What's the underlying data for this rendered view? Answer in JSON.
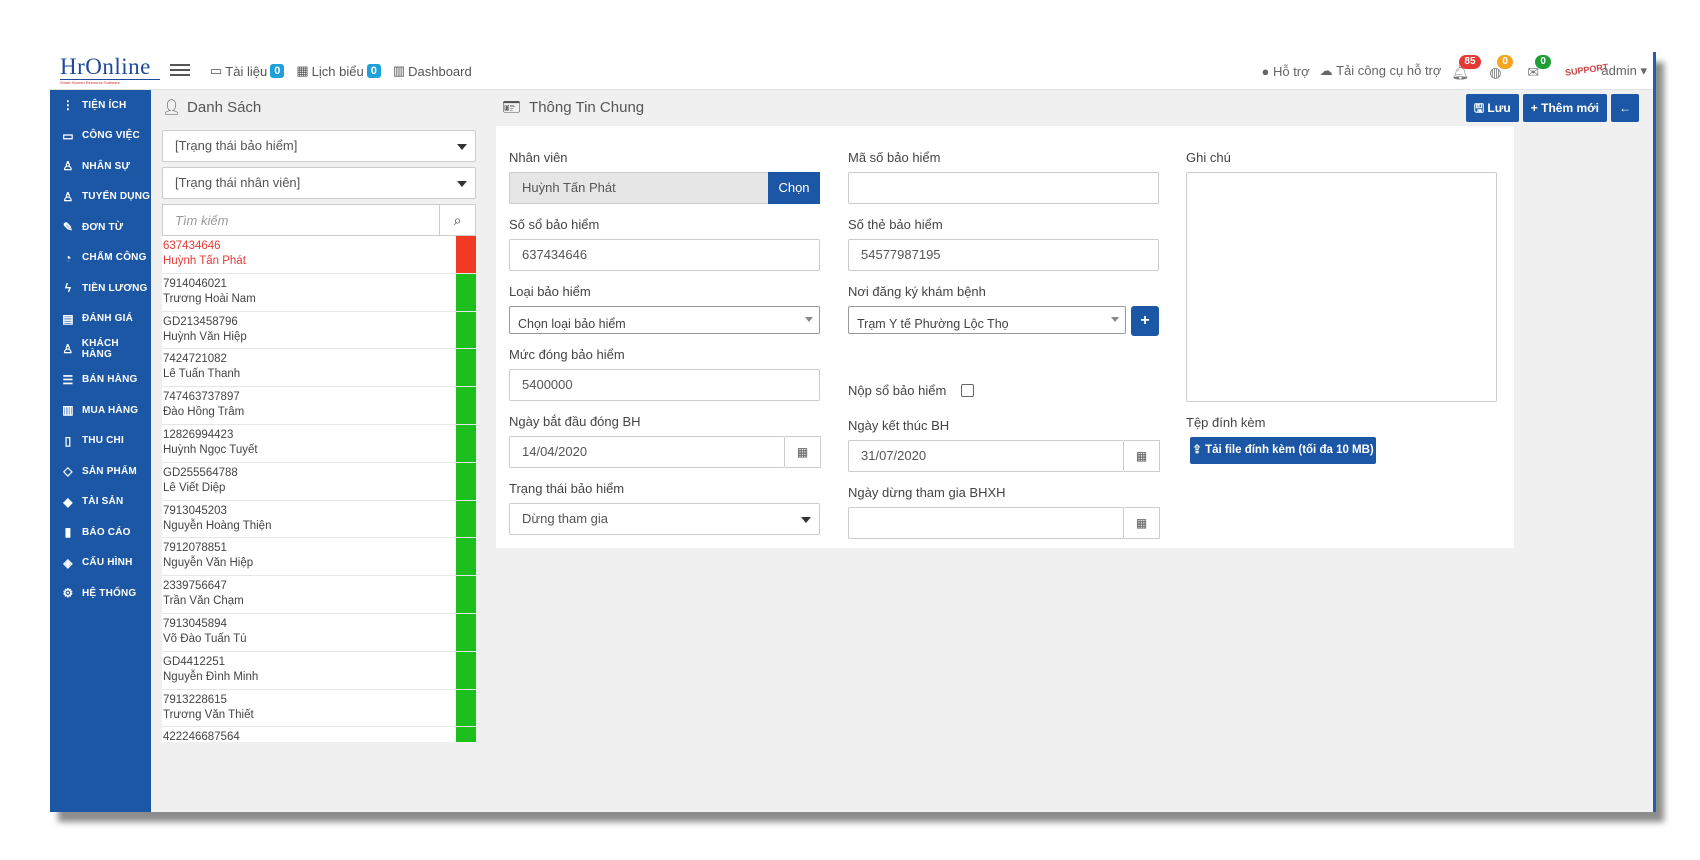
{
  "app": {
    "logo": "HrOnline",
    "logo_tagline": "Smart Human Resource Software"
  },
  "topnav": [
    {
      "label": "Tài liệu",
      "badge": "0",
      "icon": "folder-icon"
    },
    {
      "label": "Lịch biểu",
      "badge": "0",
      "icon": "calendar-icon"
    },
    {
      "label": "Dashboard",
      "icon": "bar-chart-icon"
    }
  ],
  "topright": {
    "support": "Hỗ trợ",
    "download_tool": "Tải công cụ hỗ trợ",
    "notifications": {
      "count": "85",
      "color": "#e53935"
    },
    "globe": {
      "count": "0",
      "color": "#f5a623"
    },
    "messages": {
      "count": "0",
      "color": "#1e9e34"
    },
    "avatar_text": "SUPPORT",
    "user": "admin"
  },
  "sidebar": [
    {
      "label": "TIỆN ÍCH",
      "icon": "more-vertical-icon"
    },
    {
      "label": "CÔNG VIỆC",
      "icon": "inbox-icon"
    },
    {
      "label": "NHÂN SỰ",
      "icon": "user-icon"
    },
    {
      "label": "TUYỂN DỤNG",
      "icon": "user-search-icon"
    },
    {
      "label": "ĐƠN TỪ",
      "icon": "edit-icon"
    },
    {
      "label": "CHẤM CÔNG",
      "icon": "clock-icon"
    },
    {
      "label": "TIỀN LƯƠNG",
      "icon": "bolt-icon"
    },
    {
      "label": "ĐÁNH GIÁ",
      "icon": "book-icon"
    },
    {
      "label": "KHÁCH HÀNG",
      "icon": "customer-icon"
    },
    {
      "label": "BÁN HÀNG",
      "icon": "list-icon"
    },
    {
      "label": "MUA HÀNG",
      "icon": "columns-icon"
    },
    {
      "label": "THU CHI",
      "icon": "file-icon"
    },
    {
      "label": "SẢN PHẨM",
      "icon": "tag-icon"
    },
    {
      "label": "TÀI SẢN",
      "icon": "diamond-icon"
    },
    {
      "label": "BÁO CÁO",
      "icon": "report-icon"
    },
    {
      "label": "CẤU HÌNH",
      "icon": "layers-icon"
    },
    {
      "label": "HỆ THỐNG",
      "icon": "settings-icon"
    }
  ],
  "list": {
    "title": "Danh Sách",
    "filter_insurance": "[Trạng thái bảo hiểm]",
    "filter_employee": "[Trạng thái nhân viên]",
    "search_placeholder": "Tìm kiếm",
    "items": [
      {
        "code": "637434646",
        "name": "Huỳnh Tấn Phát",
        "status_color": "#f03a24",
        "active": true
      },
      {
        "code": "7914046021",
        "name": "Trương Hoài Nam",
        "status_color": "#1cbf1c"
      },
      {
        "code": "GD213458796",
        "name": "Huỳnh Văn Hiệp",
        "status_color": "#1cbf1c"
      },
      {
        "code": "7424721082",
        "name": "Lê Tuấn Thanh",
        "status_color": "#1cbf1c"
      },
      {
        "code": "747463737897",
        "name": "Đào Hồng Trâm",
        "status_color": "#1cbf1c"
      },
      {
        "code": "12826994423",
        "name": "Huỳnh Ngọc Tuyết",
        "status_color": "#1cbf1c"
      },
      {
        "code": "GD255564788",
        "name": "Lê Viết Diệp",
        "status_color": "#1cbf1c"
      },
      {
        "code": "7913045203",
        "name": "Nguyễn Hoàng Thiện",
        "status_color": "#1cbf1c"
      },
      {
        "code": "7912078851",
        "name": "Nguyễn Văn Hiệp",
        "status_color": "#1cbf1c"
      },
      {
        "code": "2339756647",
        "name": "Trần Văn Chạm",
        "status_color": "#1cbf1c"
      },
      {
        "code": "7913045894",
        "name": "Võ Đào Tuấn Tú",
        "status_color": "#1cbf1c"
      },
      {
        "code": "GD4412251",
        "name": "Nguyễn Đình Minh",
        "status_color": "#1cbf1c"
      },
      {
        "code": "7913228615",
        "name": "Trương Văn Thiết",
        "status_color": "#1cbf1c"
      },
      {
        "code": "422246687564",
        "name": "",
        "status_color": "#1cbf1c"
      }
    ]
  },
  "detail": {
    "title": "Thông Tin Chung",
    "actions": {
      "save": "Lưu",
      "add": "Thêm mới",
      "back": "←"
    },
    "fields": {
      "employee_label": "Nhân viên",
      "employee_value": "Huỳnh Tấn Phát",
      "choose": "Chọn",
      "insurance_code_label": "Mã số bảo hiểm",
      "insurance_code_value": "",
      "note_label": "Ghi chú",
      "book_no_label": "Số sổ bảo hiểm",
      "book_no_value": "637434646",
      "card_no_label": "Số thẻ bảo hiểm",
      "card_no_value": "54577987195",
      "type_label": "Loại bảo hiểm",
      "type_value": "Chọn loại bảo hiểm",
      "clinic_label": "Nơi đăng ký khám bệnh",
      "clinic_value": "Trạm Y tế Phường Lộc Thọ",
      "amount_label": "Mức đóng bảo hiểm",
      "amount_value": "5400000",
      "submit_book_label": "Nộp sổ bảo hiểm",
      "start_label": "Ngày bắt đầu đóng BH",
      "start_value": "14/04/2020",
      "end_label": "Ngày kết thúc BH",
      "end_value": "31/07/2020",
      "attach_label": "Tệp đính kèm",
      "attach_btn": "Tải file đính kèm (tối đa 10 MB)",
      "status_label": "Trạng thái bảo hiểm",
      "status_value": "Dừng tham gia",
      "stop_label": "Ngày dừng tham gia BHXH",
      "stop_value": ""
    }
  }
}
